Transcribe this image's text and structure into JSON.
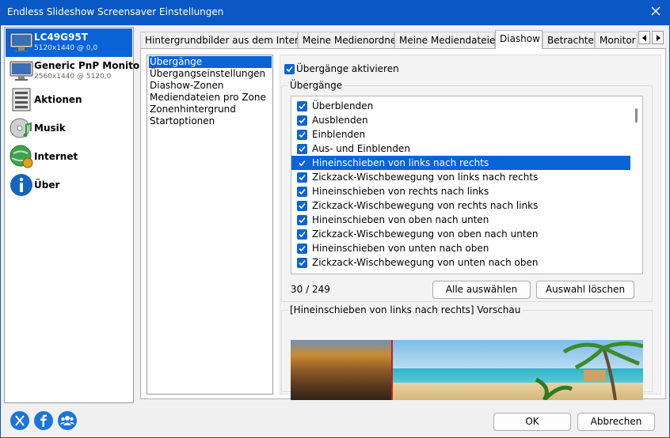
{
  "window": {
    "title": "Endless Slideshow Screensaver Einstellungen"
  },
  "sidebar": {
    "items": [
      {
        "name": "LC49G95T",
        "sub": "5120x1440 @ 0,0"
      },
      {
        "name": "Generic PnP Monitor",
        "sub": "2560x1440 @ 5120,0"
      },
      {
        "name": "Aktionen"
      },
      {
        "name": "Musik"
      },
      {
        "name": "Internet"
      },
      {
        "name": "Über"
      }
    ]
  },
  "tabs": [
    "Hintergrundbilder aus dem Internet",
    "Meine Medienordner",
    "Meine Mediendateien",
    "Diashow",
    "Betrachter",
    "Monitor ("
  ],
  "active_tab": "Diashow",
  "subnav": [
    "Übergänge",
    "Übergangseinstellungen",
    "Diashow-Zonen",
    "Mediendateien pro Zone",
    "Zonenhintergrund",
    "Startoptionen"
  ],
  "transitions_page": {
    "enable_label": "Übergänge aktivieren",
    "group_title": "Übergänge",
    "items": [
      "Überblenden",
      "Ausblenden",
      "Einblenden",
      "Aus- und Einblenden",
      "Hineinschieben von links nach rechts",
      "Zickzack-Wischbewegung von links nach rechts",
      "Hineinschieben von rechts nach links",
      "Zickzack-Wischbewegung von rechts nach links",
      "Hineinschieben von oben nach unten",
      "Zickzack-Wischbewegung von oben nach unten",
      "Hineinschieben von unten nach oben",
      "Zickzack-Wischbewegung von unten nach oben"
    ],
    "counter": "30 / 249",
    "select_all": "Alle auswählen",
    "clear_selection": "Auswahl löschen",
    "preview_title": "[Hineinschieben von links nach rechts] Vorschau"
  },
  "footer": {
    "ok": "OK",
    "cancel": "Abbrechen"
  },
  "colors": {
    "accent": "#0a64d6",
    "titlebar": "#0a57c6"
  }
}
